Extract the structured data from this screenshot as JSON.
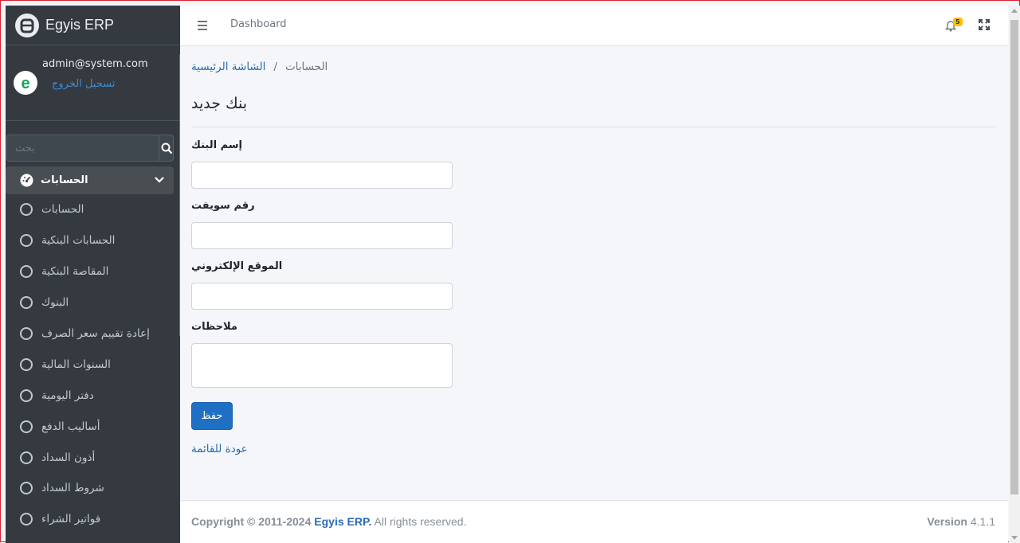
{
  "brand": {
    "name": "Egyis ERP"
  },
  "user": {
    "email": "admin@system.com",
    "logout": "تسجيل الخروج"
  },
  "sidebar": {
    "search_placeholder": "بحث",
    "group": "الحسابات",
    "items": [
      {
        "label": "الحسابات"
      },
      {
        "label": "الحسابات البنكية"
      },
      {
        "label": "المقاصة البنكية"
      },
      {
        "label": "البنوك"
      },
      {
        "label": "إعادة تقييم سعر الصرف"
      },
      {
        "label": "السنوات المالية"
      },
      {
        "label": "دفتر اليومية"
      },
      {
        "label": "أساليب الدفع"
      },
      {
        "label": "أذون السداد"
      },
      {
        "label": "شروط السداد"
      },
      {
        "label": "فواتير الشراء"
      }
    ]
  },
  "topbar": {
    "nav_link": "Dashboard",
    "notification_count": "5"
  },
  "breadcrumb": {
    "home": "الشاشة الرئيسية",
    "separator": "/",
    "current": "الحسابات"
  },
  "page": {
    "title": "بنك جديد"
  },
  "form": {
    "bank_name_label": "إسم البنك",
    "swift_label": "رقم سويفت",
    "website_label": "الموقع الإلكتروني",
    "notes_label": "ملاحظات",
    "save_label": "حفظ",
    "back_label": "عودة للقائمة"
  },
  "footer": {
    "copyright": "Copyright © 2011-2024",
    "brand": "Egyis ERP.",
    "rights": "All rights reserved.",
    "version_label": "Version",
    "version": "4.1.1"
  },
  "colors": {
    "sidebar_bg": "#343a40",
    "primary": "#1f6fc5",
    "link": "#2b6cb5",
    "badge": "#ffc107"
  }
}
